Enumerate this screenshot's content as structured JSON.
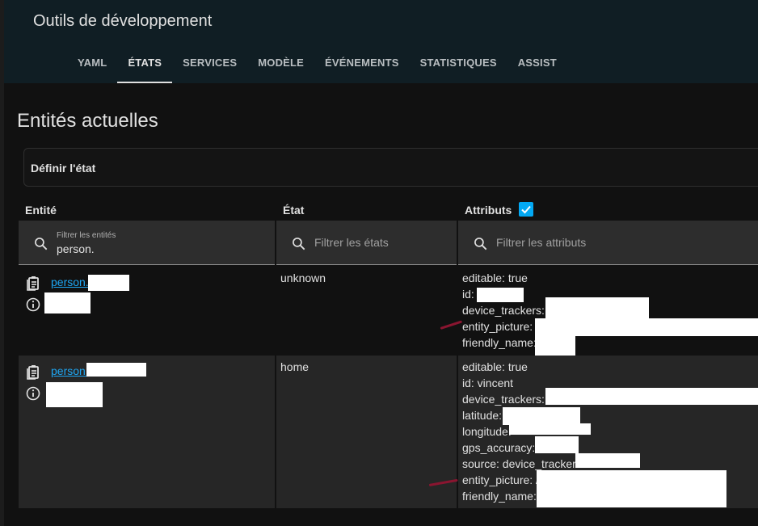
{
  "app": {
    "title": "Outils de développement"
  },
  "tabs": [
    {
      "label": "YAML",
      "active": false
    },
    {
      "label": "ÉTATS",
      "active": true
    },
    {
      "label": "SERVICES",
      "active": false
    },
    {
      "label": "MODÈLE",
      "active": false
    },
    {
      "label": "ÉVÉNEMENTS",
      "active": false
    },
    {
      "label": "STATISTIQUES",
      "active": false
    },
    {
      "label": "ASSIST",
      "active": false
    }
  ],
  "page": {
    "section_title": "Entités actuelles",
    "set_state_label": "Définir l'état"
  },
  "columns": {
    "entity": "Entité",
    "state": "État",
    "attributes": "Attributs",
    "attributes_checked": true
  },
  "filters": {
    "entity_label": "Filtrer les entités",
    "entity_value": "person.",
    "state_placeholder": "Filtrer les états",
    "attributes_placeholder": "Filtrer les attributs"
  },
  "rows": [
    {
      "entity_id": "person.",
      "state": "unknown",
      "attributes": [
        "editable: true",
        "id:",
        "device_trackers:",
        "entity_picture:",
        "friendly_name:"
      ]
    },
    {
      "entity_id": "person.",
      "state": "home",
      "attributes": [
        "editable: true",
        "id: vincent",
        "device_trackers:",
        "latitude:",
        "longitude:",
        "gps_accuracy:",
        "source: device_tracker.",
        "entity_picture: /",
        "friendly_name:"
      ]
    }
  ],
  "colors": {
    "accent": "#03a9f4",
    "link": "#1ea7f4",
    "annotation_mark": "#8a1530"
  }
}
